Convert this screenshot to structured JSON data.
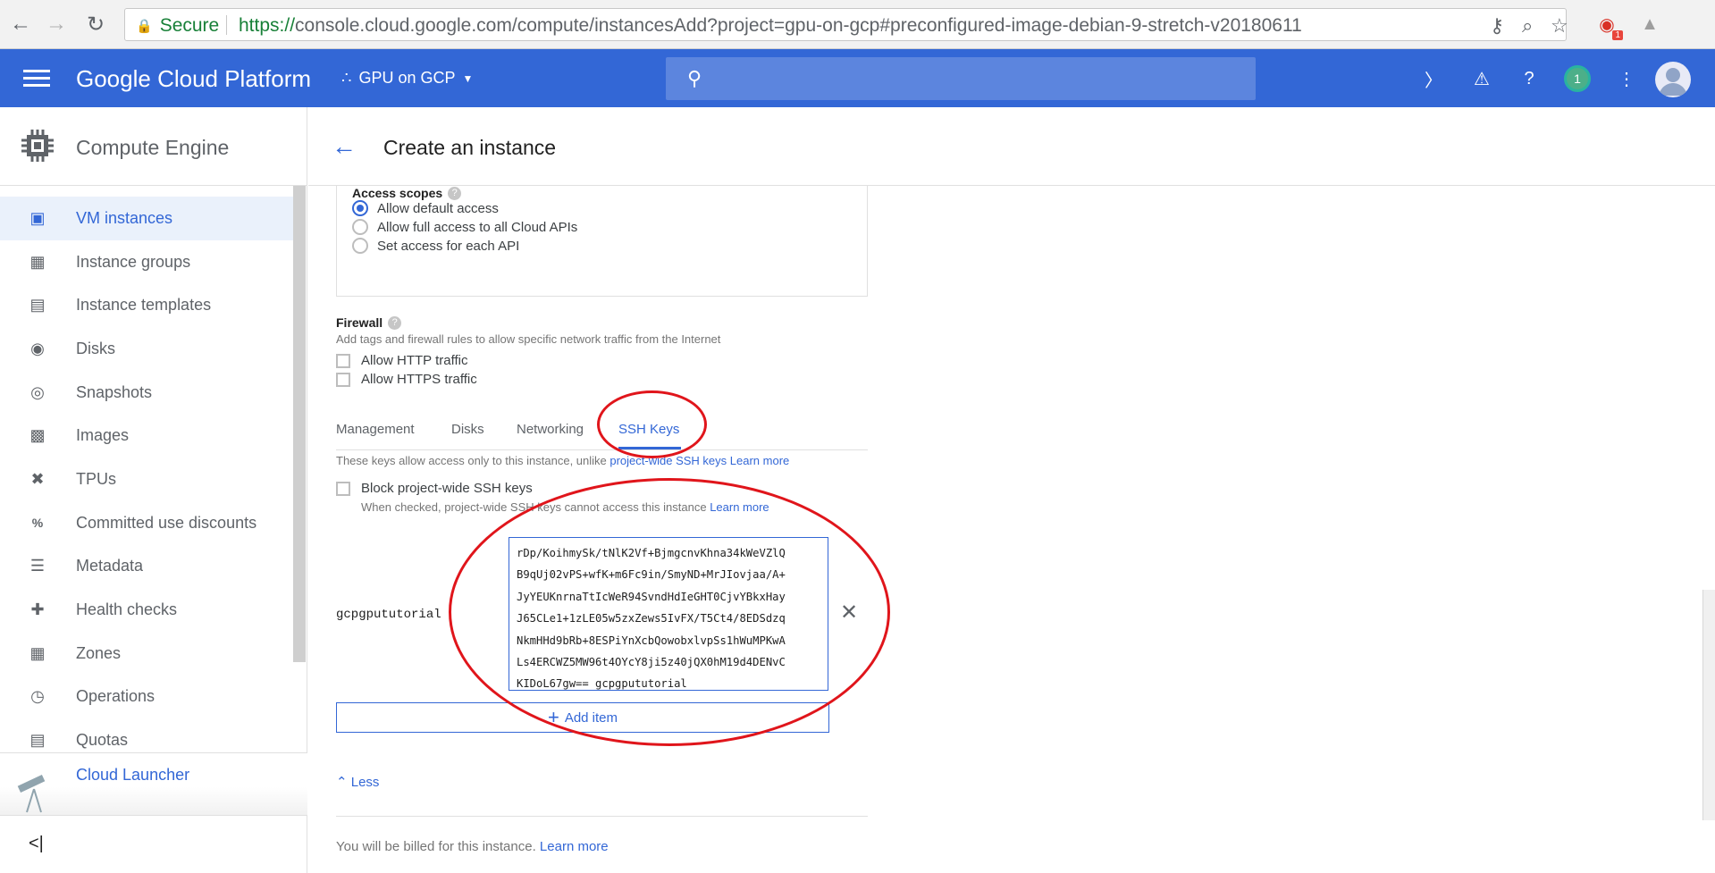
{
  "browser": {
    "secure_label": "Secure",
    "url_scheme": "https://",
    "url_rest": "console.cloud.google.com/compute/instancesAdd?project=gpu-on-gcp#preconfigured-image-debian-9-stretch-v20180611",
    "extension_badge": "1",
    "icons": [
      "back-icon",
      "forward-icon",
      "reload-icon",
      "lock-icon",
      "key-icon",
      "zoom-icon",
      "star-icon",
      "extension-icon",
      "pdf-icon"
    ]
  },
  "header": {
    "brand": "Google Cloud Platform",
    "project": "GPU on GCP",
    "notification_count": "1",
    "color": "#3367d6"
  },
  "sidebar": {
    "product": "Compute Engine",
    "items": [
      {
        "label": "VM instances",
        "icon": "vm-instances-icon",
        "active": true
      },
      {
        "label": "Instance groups",
        "icon": "instance-groups-icon"
      },
      {
        "label": "Instance templates",
        "icon": "instance-templates-icon"
      },
      {
        "label": "Disks",
        "icon": "disk-icon"
      },
      {
        "label": "Snapshots",
        "icon": "snapshot-icon"
      },
      {
        "label": "Images",
        "icon": "images-icon"
      },
      {
        "label": "TPUs",
        "icon": "tpu-icon"
      },
      {
        "label": "Committed use discounts",
        "icon": "discount-icon"
      },
      {
        "label": "Metadata",
        "icon": "metadata-icon"
      },
      {
        "label": "Health checks",
        "icon": "health-checks-icon"
      },
      {
        "label": "Zones",
        "icon": "zones-icon"
      },
      {
        "label": "Operations",
        "icon": "operations-icon"
      },
      {
        "label": "Quotas",
        "icon": "quotas-icon"
      }
    ],
    "launcher": "Cloud Launcher",
    "collapse": "<|"
  },
  "page": {
    "title": "Create an instance"
  },
  "access_scopes": {
    "label": "Access scopes",
    "options": [
      "Allow default access",
      "Allow full access to all Cloud APIs",
      "Set access for each API"
    ],
    "selected": 0
  },
  "firewall": {
    "label": "Firewall",
    "description": "Add tags and firewall rules to allow specific network traffic from the Internet",
    "options": [
      "Allow HTTP traffic",
      "Allow HTTPS traffic"
    ]
  },
  "tabs": {
    "items": [
      "Management",
      "Disks",
      "Networking",
      "SSH Keys"
    ],
    "active": "SSH Keys"
  },
  "ssh": {
    "intro": "These keys allow access only to this instance, unlike ",
    "intro_link": "project-wide SSH keys",
    "learn_more": "Learn more",
    "block_label": "Block project-wide SSH keys",
    "block_desc": "When checked, project-wide SSH keys cannot access this instance ",
    "username": "gcpgpututorial",
    "key_text": "rDp/KoihmySk/tNlK2Vf+BjmgcnvKhna34kWeVZlQ\nB9qUj02vPS+wfK+m6Fc9in/SmyND+MrJIovjaa/A+\nJyYEUKnrnaTtIcWeR94SvndHdIeGHT0CjvYBkxHay\nJ65CLe1+1zLE05w5zxZews5IvFX/T5Ct4/8EDSdzq\nNkmHHd9bRb+8ESPiYnXcbQowobxlvpSs1hWuMPKwA\nLs4ERCWZ5MW96t4OYcY8ji5z40jQX0hM19d4DENvC\nKIDoL67gw== gcpgpututorial",
    "add_item": "Add item"
  },
  "less": "Less",
  "billing": {
    "text": "You will be billed for this instance. ",
    "link": "Learn more"
  },
  "annotation_color": "#e0151b"
}
